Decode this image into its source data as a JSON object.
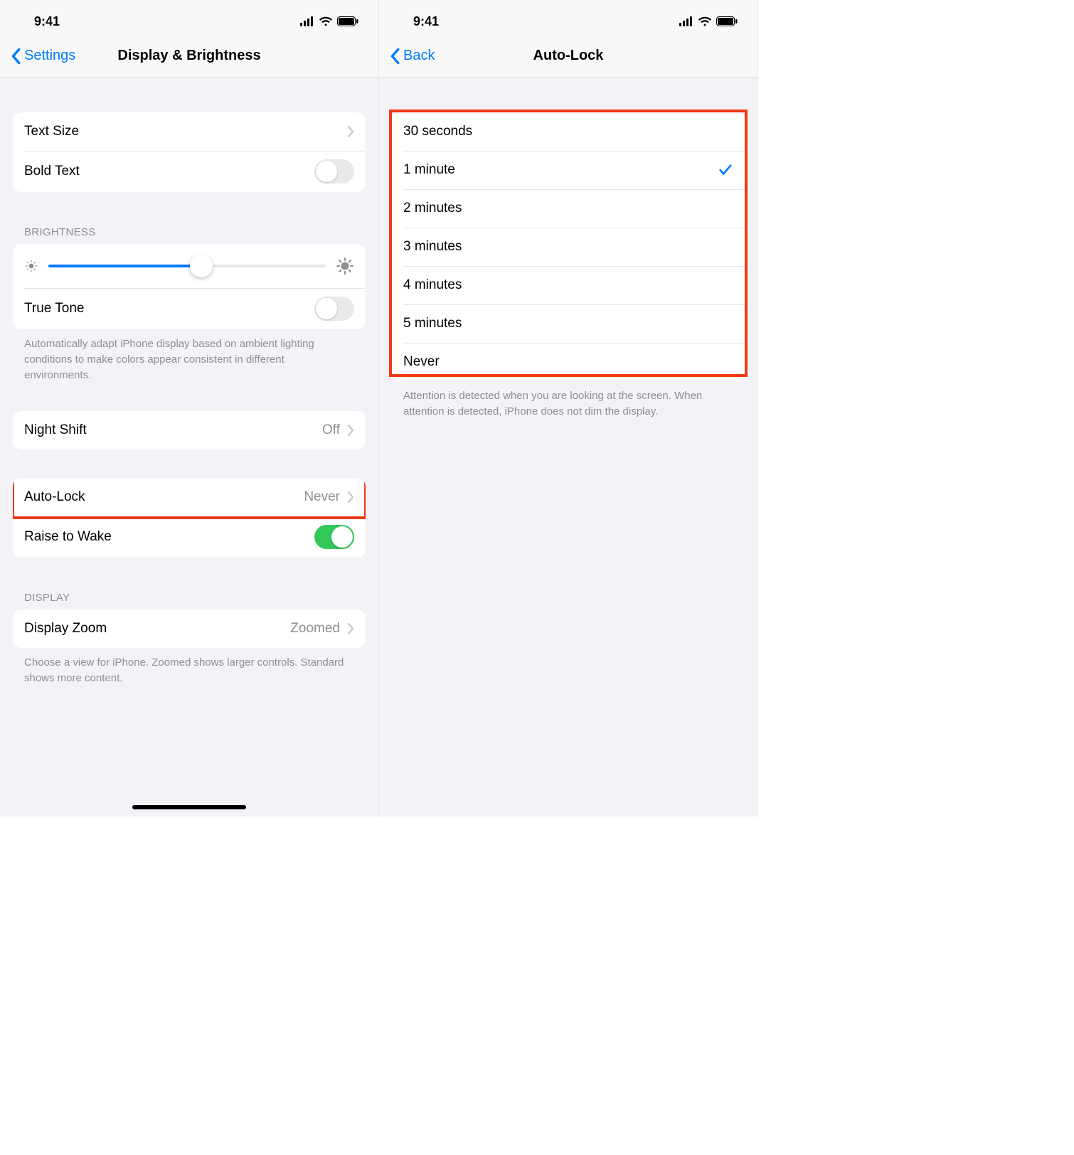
{
  "status": {
    "time": "9:41"
  },
  "left": {
    "nav": {
      "back": "Settings",
      "title": "Display & Brightness"
    },
    "rows": {
      "text_size": "Text Size",
      "bold_text": "Bold Text",
      "brightness_header": "Brightness",
      "true_tone": "True Tone",
      "true_tone_footer": "Automatically adapt iPhone display based on ambient lighting conditions to make colors appear consistent in different environments.",
      "night_shift": {
        "label": "Night Shift",
        "value": "Off"
      },
      "auto_lock": {
        "label": "Auto-Lock",
        "value": "Never"
      },
      "raise_to_wake": "Raise to Wake",
      "display_header": "Display",
      "display_zoom": {
        "label": "Display Zoom",
        "value": "Zoomed"
      },
      "display_zoom_footer": "Choose a view for iPhone. Zoomed shows larger controls. Standard shows more content."
    },
    "toggles": {
      "bold_text": false,
      "true_tone": false,
      "raise_to_wake": true
    },
    "brightness_percent": 55
  },
  "right": {
    "nav": {
      "back": "Back",
      "title": "Auto-Lock"
    },
    "options": [
      {
        "label": "30 seconds",
        "selected": false
      },
      {
        "label": "1 minute",
        "selected": true
      },
      {
        "label": "2 minutes",
        "selected": false
      },
      {
        "label": "3 minutes",
        "selected": false
      },
      {
        "label": "4 minutes",
        "selected": false
      },
      {
        "label": "5 minutes",
        "selected": false
      },
      {
        "label": "Never",
        "selected": false
      }
    ],
    "footer": "Attention is detected when you are looking at the screen. When attention is detected, iPhone does not dim the display."
  }
}
